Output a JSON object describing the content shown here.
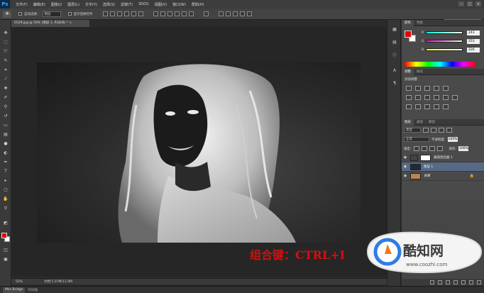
{
  "app": {
    "logo": "Ps",
    "window_controls": [
      "–",
      "□",
      "×"
    ]
  },
  "menu": [
    "文件(F)",
    "编辑(E)",
    "图像(I)",
    "图层(L)",
    "文字(Y)",
    "选择(S)",
    "滤镜(T)",
    "3D(D)",
    "视图(V)",
    "窗口(W)",
    "帮助(H)"
  ],
  "options": {
    "auto_select_label": "自动选择：",
    "auto_select_value": "图层",
    "show_transform_label": "显示变换控件",
    "workspace": "基本功能"
  },
  "document": {
    "tab": "0529.jpg @ 50% (图层 1, RGB/8) * ×",
    "zoom": "50%",
    "info": "文档:5.07M/11.9M"
  },
  "overlay_text": "组合键：CTRL+I",
  "bridge": {
    "tab1": "Mini Bridge",
    "tab2": "时间轴"
  },
  "color_panel": {
    "tabs": [
      "颜色",
      "色板"
    ],
    "r": "243",
    "g": "253",
    "b": "226"
  },
  "adjustments": {
    "tabs": [
      "调整",
      "样式"
    ],
    "title": "添加调整"
  },
  "layers": {
    "tabs": [
      "图层",
      "通道",
      "路径"
    ],
    "kind": "类型",
    "blend": "正常",
    "opacity_label": "不透明度:",
    "opacity": "100%",
    "lock_label": "锁定:",
    "fill_label": "填充:",
    "fill": "100%",
    "rows": [
      {
        "name": "通道混合器 1"
      },
      {
        "name": "图层 1"
      },
      {
        "name": "背景"
      }
    ]
  },
  "watermark": {
    "name": "酷知网",
    "url": "www.coozhi.com"
  },
  "colors": {
    "accent": "#576a85",
    "foreground": "#e00000",
    "overlay": "#d21010"
  }
}
